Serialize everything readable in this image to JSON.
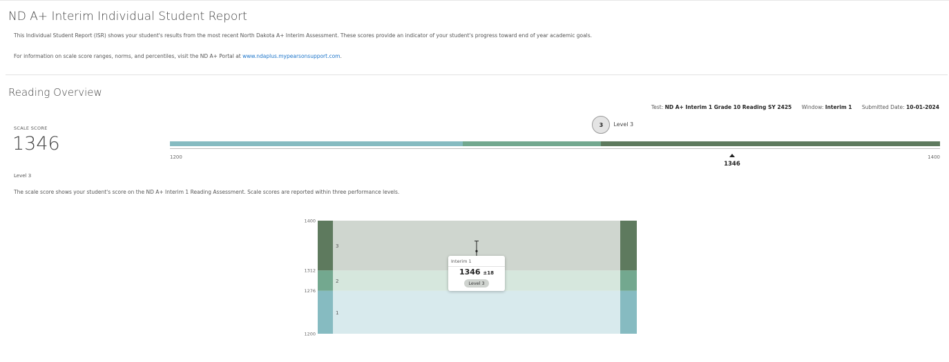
{
  "header": {
    "title": "ND A+ Interim Individual Student Report",
    "intro": "This Individual Student Report (ISR) shows your student's results from the most recent North Dakota A+ Interim Assessment. These scores provide an indicator of your student's progress toward end of year academic goals.",
    "info_prefix": "For information on scale score ranges, norms, and percentiles, visit the ND A+ Portal at ",
    "info_link": "www.ndaplus.mypearsonsupport.com",
    "info_suffix": "."
  },
  "section": {
    "title": "Reading Overview",
    "test_label": "Test: ",
    "test_value": "ND A+ Interim 1 Grade 10 Reading SY 2425",
    "window_label": "Window: ",
    "window_value": "Interim 1",
    "date_label": "Submitted Date: ",
    "date_value": "10-01-2024"
  },
  "score": {
    "label": "SCALE SCORE",
    "value": "1346",
    "level_text": "Level 3",
    "description": "The scale score shows your student's score on the ND A+ Interim 1 Reading Assessment. Scale scores are reported within three performance levels.",
    "badge_number": "3",
    "badge_label": "Level 3"
  },
  "colors": {
    "level1": "#86bbc1",
    "level2": "#73a88f",
    "level3": "#5e7a5e",
    "level1_bg": "#d8eaed",
    "level2_bg": "#d6e7dd",
    "level3_bg": "#cfd6cf"
  },
  "chart_data": {
    "type": "bar",
    "scale_min": 1200,
    "scale_max": 1400,
    "scale_min_label": "1200",
    "scale_max_label": "1400",
    "levels": [
      {
        "name": "1",
        "from": 1200,
        "to": 1276
      },
      {
        "name": "2",
        "from": 1276,
        "to": 1312
      },
      {
        "name": "3",
        "from": 1312,
        "to": 1400
      }
    ],
    "y_ticks": [
      "1400",
      "1312",
      "1276",
      "1200"
    ],
    "score": 1346,
    "score_label": "1346",
    "sem": 18,
    "tooltip": {
      "window": "Interim 1",
      "score": "1346",
      "sem": "±18",
      "level": "Level 3"
    }
  }
}
